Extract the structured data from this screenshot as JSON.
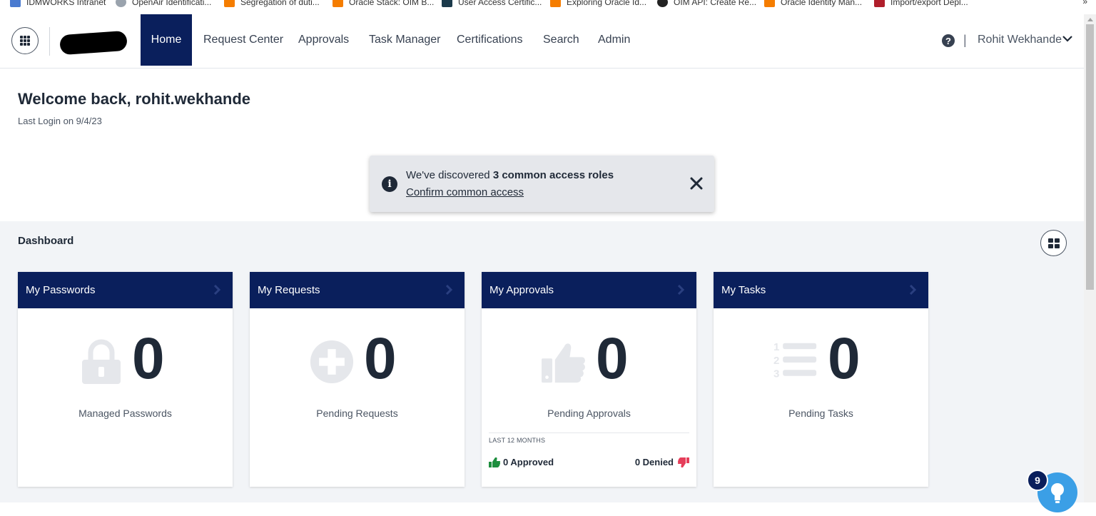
{
  "bookmarks": [
    {
      "label": "IDMWORKS Intranet",
      "icon": "document-icon",
      "color": "#4a7bd0"
    },
    {
      "label": "OpenAir Identificati...",
      "icon": "cloud-icon",
      "color": "#9aa3ad"
    },
    {
      "label": "Segregation of duti...",
      "icon": "blogger-icon",
      "color": "#f57d00"
    },
    {
      "label": "Oracle Stack: OIM B...",
      "icon": "blogger-icon",
      "color": "#f57d00"
    },
    {
      "label": "User Access Certific...",
      "icon": "site-icon",
      "color": "#1b3a4b"
    },
    {
      "label": "Exploring Oracle Id...",
      "icon": "blogger-icon",
      "color": "#f57d00"
    },
    {
      "label": "OIM API: Create Re...",
      "icon": "github-icon",
      "color": "#222222"
    },
    {
      "label": "Oracle Identity Man...",
      "icon": "blogger-icon",
      "color": "#f57d00"
    },
    {
      "label": "Import/export Depl...",
      "icon": "dice-icon",
      "color": "#b01e2b"
    }
  ],
  "bookmarks_more": "»",
  "nav": {
    "items": [
      "Home",
      "Request Center",
      "Approvals",
      "Task Manager",
      "Certifications",
      "Search",
      "Admin"
    ],
    "help": "?",
    "separator": "|",
    "user": "Rohit Wekhande"
  },
  "welcome": {
    "title": "Welcome back, rohit.wekhande",
    "last_login": "Last Login on 9/4/23"
  },
  "toast": {
    "prefix": "We've discovered ",
    "bold": "3 common access roles",
    "link": "Confirm common access",
    "info": "i"
  },
  "dashboard": {
    "title": "Dashboard",
    "cards": [
      {
        "title": "My Passwords",
        "count": "0",
        "label": "Managed Passwords",
        "icon": "lock-icon"
      },
      {
        "title": "My Requests",
        "count": "0",
        "label": "Pending Requests",
        "icon": "plus-circle-icon"
      },
      {
        "title": "My Approvals",
        "count": "0",
        "label": "Pending Approvals",
        "icon": "thumbs-up-icon"
      },
      {
        "title": "My Tasks",
        "count": "0",
        "label": "Pending Tasks",
        "icon": "numbered-list-icon"
      }
    ],
    "approvals_footer": {
      "period": "LAST 12 MONTHS",
      "approved": "0 Approved",
      "denied": "0 Denied"
    }
  },
  "fab": {
    "badge": "9",
    "icon": "lightbulb-icon"
  },
  "colors": {
    "brand_navy": "#0a1f5c",
    "dashboard_bg": "#f2f4f7",
    "fab_blue": "#3b9fe6",
    "approved_green": "#1e8e3e",
    "denied_red": "#e53e5a"
  }
}
